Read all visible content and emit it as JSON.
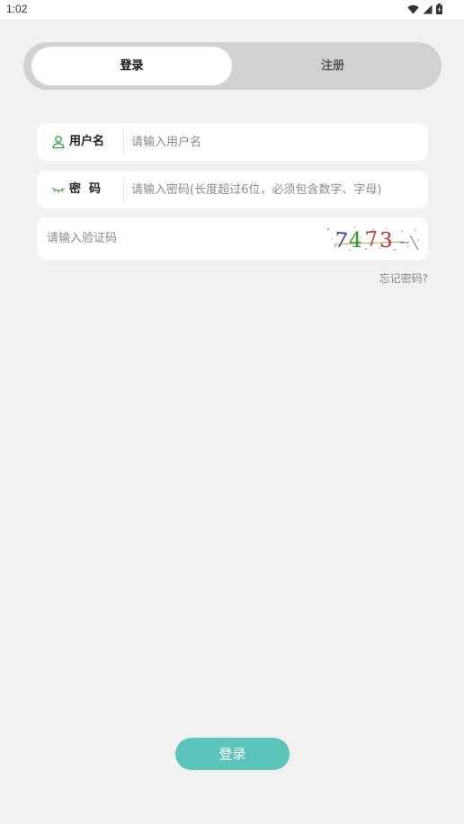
{
  "status_bar": {
    "time": "1:02",
    "icons": [
      "wifi-icon",
      "cellular-signal-icon",
      "battery-icon"
    ]
  },
  "tabs": [
    {
      "label": "登录",
      "active": true
    },
    {
      "label": "注册",
      "active": false
    }
  ],
  "form": {
    "username": {
      "label": "用户名",
      "placeholder": "请输入用户名",
      "value": "",
      "icon": "user-icon"
    },
    "password": {
      "label": "密  码",
      "placeholder": "请输入密码(长度超过6位，必须包含数字、字母)",
      "value": "",
      "icon": "eye-closed-icon"
    },
    "captcha": {
      "placeholder": "请输入验证码",
      "value": "",
      "code": "7473"
    },
    "forgot_label": "忘记密码?"
  },
  "submit_label": "登录",
  "colors": {
    "accent": "#5cc5bb",
    "icon_green": "#2aa44a",
    "background": "#f1f1f1",
    "tab_track": "#d1d1d3"
  }
}
